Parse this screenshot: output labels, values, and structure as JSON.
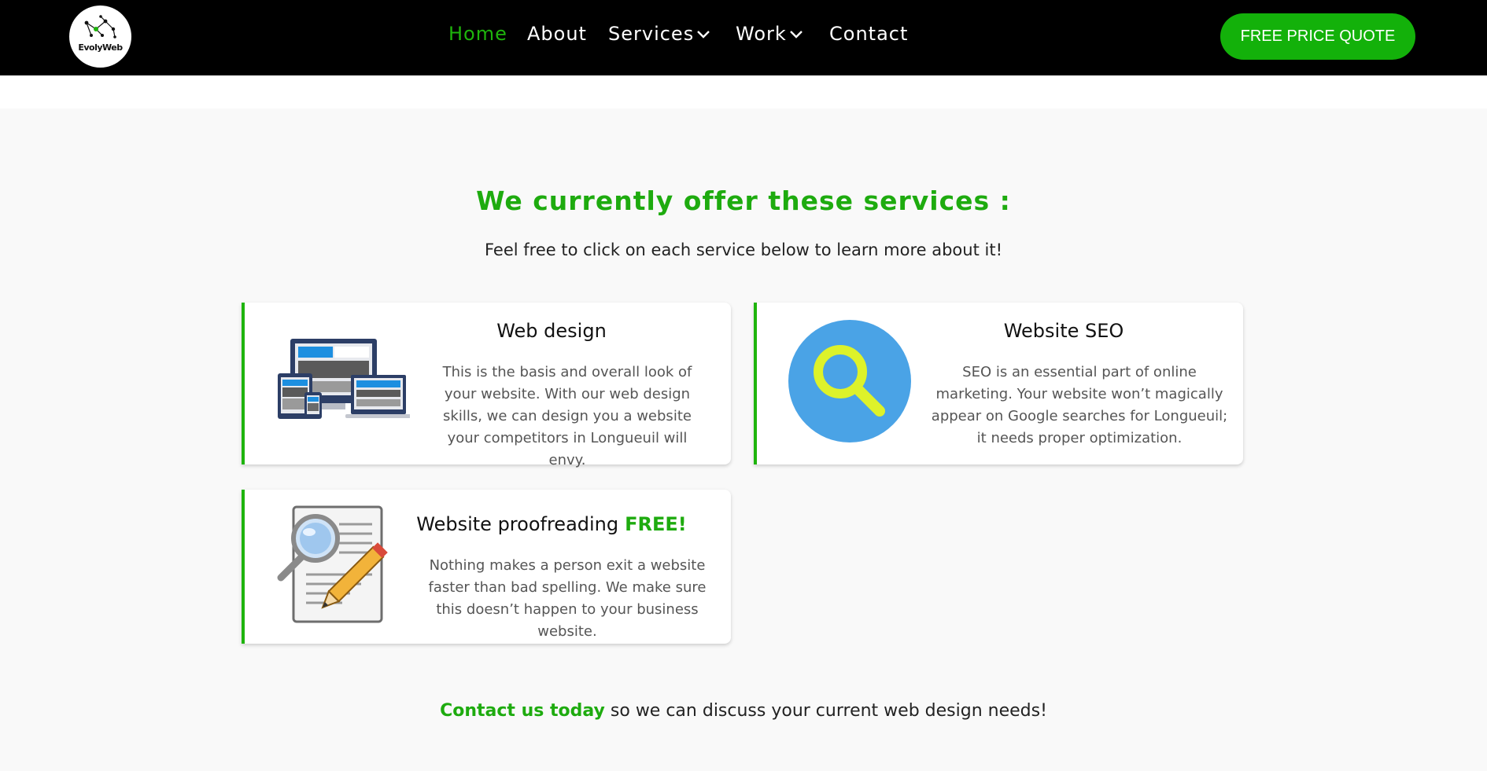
{
  "header": {
    "logo_text": "EvolyWeb",
    "nav": [
      {
        "label": "Home",
        "active": true
      },
      {
        "label": "About"
      },
      {
        "label": "Services",
        "dropdown": true
      },
      {
        "label": "Work",
        "dropdown": true
      },
      {
        "label": "Contact"
      }
    ],
    "cta_label": "FREE PRICE QUOTE"
  },
  "colors": {
    "accent": "#1eab0f",
    "header_bg": "#000000",
    "card_border": "#1eb40c",
    "seo_circle": "#4aa3e6",
    "seo_glass": "#ddf22a"
  },
  "services": {
    "title": "We currently offer these services :",
    "subtitle": "Feel free to click on each service below to learn more about it!",
    "cards": [
      {
        "icon": "responsive-devices-icon",
        "title": "Web design",
        "text": "This is the basis and overall look of your website. With our web design skills, we can design you a website your competitors in Longueuil will envy."
      },
      {
        "icon": "magnifier-icon",
        "title": "Website SEO",
        "text": "SEO is an essential part of online marketing. Your website won’t magically appear on Google searches for Longueuil; it needs proper optimization."
      },
      {
        "icon": "proofreading-icon",
        "title": "Website proofreading",
        "badge": "FREE!",
        "text": "Nothing makes a person exit a website faster than bad spelling. We make sure this doesn’t happen to your business website."
      }
    ]
  },
  "contact": {
    "link_label": "Contact us today",
    "rest": " so we can discuss your current web design needs!"
  }
}
